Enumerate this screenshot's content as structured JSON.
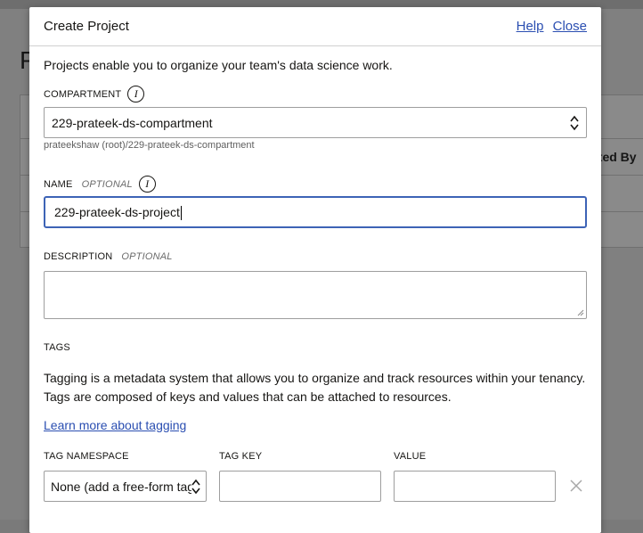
{
  "background": {
    "title_letter": "P",
    "column_header": "ated By"
  },
  "modal": {
    "title": "Create Project",
    "help_link": "Help",
    "close_link": "Close",
    "intro": "Projects enable you to organize your team's data science work.",
    "compartment": {
      "label": "COMPARTMENT",
      "value": "229-prateek-ds-compartment",
      "hint": "prateekshaw (root)/229-prateek-ds-compartment"
    },
    "name": {
      "label": "NAME",
      "optional": "OPTIONAL",
      "value": "229-prateek-ds-project"
    },
    "description": {
      "label": "DESCRIPTION",
      "optional": "OPTIONAL",
      "value": ""
    },
    "tags": {
      "label": "TAGS",
      "description": "Tagging is a metadata system that allows you to organize and track resources within your tenancy. Tags are composed of keys and values that can be attached to resources.",
      "learn_more": "Learn more about tagging",
      "namespace_label": "TAG NAMESPACE",
      "namespace_value": "None (add a free-form tag)",
      "key_label": "TAG KEY",
      "key_value": "",
      "value_label": "VALUE",
      "value_value": ""
    }
  },
  "colors": {
    "link": "#2a4eb1",
    "focus_border": "#3d63b6",
    "overlay": "#808080"
  },
  "icons": {
    "info": "info-icon",
    "select_arrows": "updown-chevron-icon",
    "remove": "close-x-icon"
  }
}
